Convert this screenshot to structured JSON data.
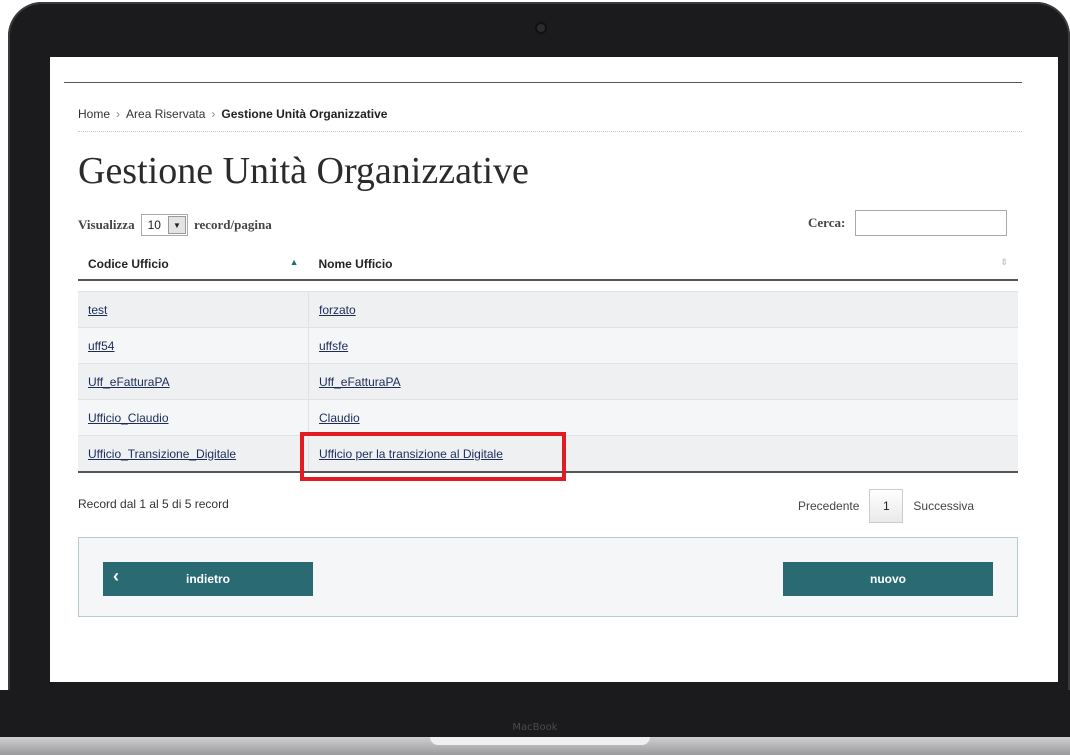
{
  "device": {
    "brand": "MacBook"
  },
  "breadcrumb": {
    "items": [
      "Home",
      "Area Riservata"
    ],
    "current": "Gestione Unità Organizzative",
    "separator": "›"
  },
  "page": {
    "title": "Gestione Unità Organizzative"
  },
  "length_control": {
    "prefix": "Visualizza",
    "value": "10",
    "suffix": "record/pagina"
  },
  "search": {
    "label": "Cerca:",
    "value": ""
  },
  "table": {
    "columns": [
      "Codice Ufficio",
      "Nome Ufficio"
    ],
    "sort_asc_glyph": "▲",
    "sort_both_glyph": "⇕",
    "rows": [
      [
        "test",
        "forzato"
      ],
      [
        "uff54",
        "uffsfe"
      ],
      [
        "Uff_eFatturaPA",
        "Uff_eFatturaPA"
      ],
      [
        "Ufficio_Claudio",
        "Claudio"
      ],
      [
        "Ufficio_Transizione_Digitale",
        "Ufficio per la transizione al Digitale"
      ]
    ]
  },
  "info": {
    "text": "Record dal 1 al 5 di 5 record"
  },
  "pagination": {
    "previous": "Precedente",
    "current": "1",
    "next": "Successiva"
  },
  "buttons": {
    "back": "indietro",
    "back_icon": "‹",
    "new": "nuovo"
  },
  "colors": {
    "accent": "#2a6b73",
    "highlight": "#e11b22"
  }
}
